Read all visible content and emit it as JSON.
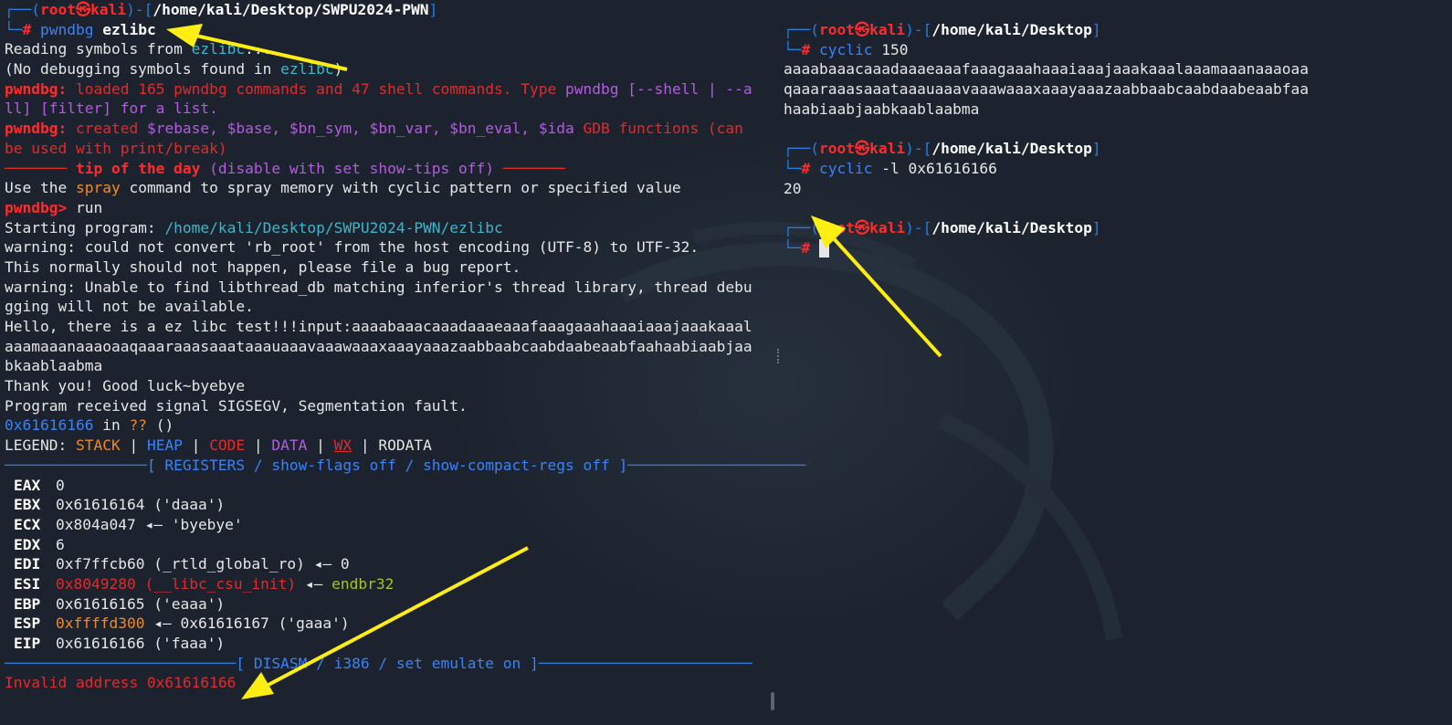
{
  "prompt": {
    "user": "root",
    "host": "kali",
    "at_symbol": "㉿",
    "hash": "#"
  },
  "left": {
    "cwd": "/home/kali/Desktop/SWPU2024-PWN",
    "cmd": "pwndbg",
    "cmd_arg": "ezlibc",
    "reading_prefix": "Reading symbols from ",
    "reading_file": "ezlibc",
    "reading_suffix": "...",
    "nodebug_prefix": "(No debugging symbols found in ",
    "nodebug_file": "ezlibc",
    "nodebug_suffix": ")",
    "pwndbg_tag": "pwndbg:",
    "loaded_1": " loaded 165 pwndbg commands and 47 shell commands. Type ",
    "loaded_2": "pwndbg",
    "loaded_3": " [--shell | --a",
    "loaded_4": "ll] [filter] for a list.",
    "created_1": " created ",
    "created_2": "$rebase, $base, $bn_sym, $bn_var, $bn_eval, $ida",
    "created_3": " GDB functions (can",
    "created_4": "be used with print/break)",
    "tip_lead": "─────── ",
    "tip_title": "tip of the day",
    "tip_mid_1": " (disable with ",
    "tip_mid_2": "set show-tips off",
    "tip_mid_3": ") ",
    "tip_trail": "───────",
    "tip_text_1": "Use the ",
    "tip_text_2": "spray",
    "tip_text_3": " command to spray memory with cyclic pattern or specified value",
    "prompt_pwndbg": "pwndbg>",
    "run_cmd": " run",
    "starting_1": "Starting program: ",
    "starting_2": "/home/kali/Desktop/SWPU2024-PWN/ezlibc",
    "warn1": "warning: could not convert 'rb_root' from the host encoding (UTF-8) to UTF-32.",
    "warn2": "This normally should not happen, please file a bug report.",
    "warn3": "warning: Unable to find libthread_db matching inferior's thread library, thread debu",
    "warn4": "gging will not be available.",
    "hello1": "Hello, there is a ez libc test!!!input:aaaabaaacaaadaaaeaaafaaagaaahaaaiaaajaaakaaal",
    "hello2": "aaamaaanaaaoaaqaaaraaasaaataaauaaavaaawaaaxaaayaaazaabbaabcaabdaabeaabfaahaabiaabjaa",
    "hello3": "bkaablaabma",
    "thanks": "Thank you! Good luck~byebye",
    "signal": "Program received signal SIGSEGV, Segmentation fault.",
    "fault_addr": "0x61616166",
    "fault_in": " in ",
    "fault_q": "??",
    "fault_paren": " ()",
    "legend_label": "LEGEND: ",
    "legend_stack": "STACK",
    "legend_heap": "HEAP",
    "legend_code": "CODE",
    "legend_data": "DATA",
    "legend_wx": "WX",
    "legend_rodata": "RODATA",
    "legend_sep": " | ",
    "regs_header_left": "────────────────",
    "regs_header_title": "[ REGISTERS / show-flags off / show-compact-regs off ]",
    "regs_header_right": "────────────────────",
    "registers": [
      {
        "name": "EAX",
        "val": "0",
        "rest": ""
      },
      {
        "name": "EBX",
        "val": "0x61616164",
        "rest": " ('daaa')"
      },
      {
        "name": "ECX",
        "val": "0x804a047",
        "rest": " ◂— 'byebye'"
      },
      {
        "name": "EDX",
        "val": "6",
        "rest": ""
      },
      {
        "name": "EDI",
        "val": "0xf7ffcb60",
        "rest": " (_rtld_global_ro) ◂— 0"
      },
      {
        "name": "ESI",
        "val": "0x8049280",
        "rest_red": " (__libc_csu_init)",
        "rest_arrow": " ◂— ",
        "rest_green": "endbr32"
      },
      {
        "name": "EBP",
        "val": "0x61616165",
        "rest": " ('eaaa')"
      },
      {
        "name": "ESP",
        "val": "0xffffd300",
        "rest": " ◂— 0x61616167 ('gaaa')"
      },
      {
        "name": "EIP",
        "val": "0x61616166",
        "rest": " ('faaa')"
      }
    ],
    "disasm_left": "──────────────────────────",
    "disasm_title": "[ DISASM / i386 / set emulate on ]",
    "disasm_right": "────────────────────────",
    "invalid": "Invalid address 0x61616166"
  },
  "right": {
    "cwd": "/home/kali/Desktop",
    "cmd1": "cyclic",
    "cmd1_arg": " 150",
    "out1_1": "aaaabaaacaaadaaaeaaafaaagaaahaaaiaaajaaakaaalaaamaaanaaaoaa",
    "out1_2": "qaaaraaasaaataaauaaavaaawaaaxaaayaaazaabbaabcaabdaabeaabfaa",
    "out1_3": "haabiaabjaabkaablaabma",
    "cmd2": "cyclic",
    "cmd2_arg": " -l 0x61616166",
    "out2": "20"
  },
  "colors": {
    "prompt_blue": "#2a7bde",
    "prompt_red": "#ff2b2b",
    "arrow_yellow": "#ffee11",
    "bg": "#1c232e"
  }
}
